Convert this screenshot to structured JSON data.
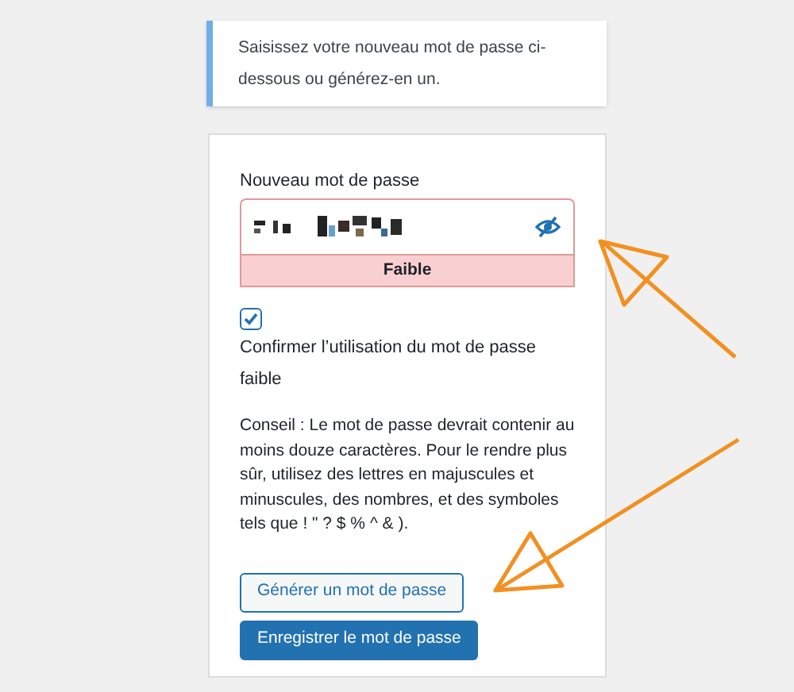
{
  "notice": "Saisissez votre nouveau mot de passe ci-dessous ou générez-en un.",
  "password": {
    "label": "Nouveau mot de passe",
    "visible": false,
    "strength_label": "Faible"
  },
  "confirm_weak": {
    "label": "Confirmer l’utilisation du mot de passe faible",
    "checked": true
  },
  "hint": "Conseil : Le mot de passe devrait contenir au moins douze caractères. Pour le rendre plus sûr, utilisez des lettres en majuscules et minuscules, des nombres, et des symboles tels que ! \" ? $ % ^ & ).",
  "buttons": [
    {
      "label": "Générer un mot de passe",
      "kind": "secondary"
    },
    {
      "label": "Enregistrer le mot de passe",
      "kind": "primary"
    }
  ]
}
